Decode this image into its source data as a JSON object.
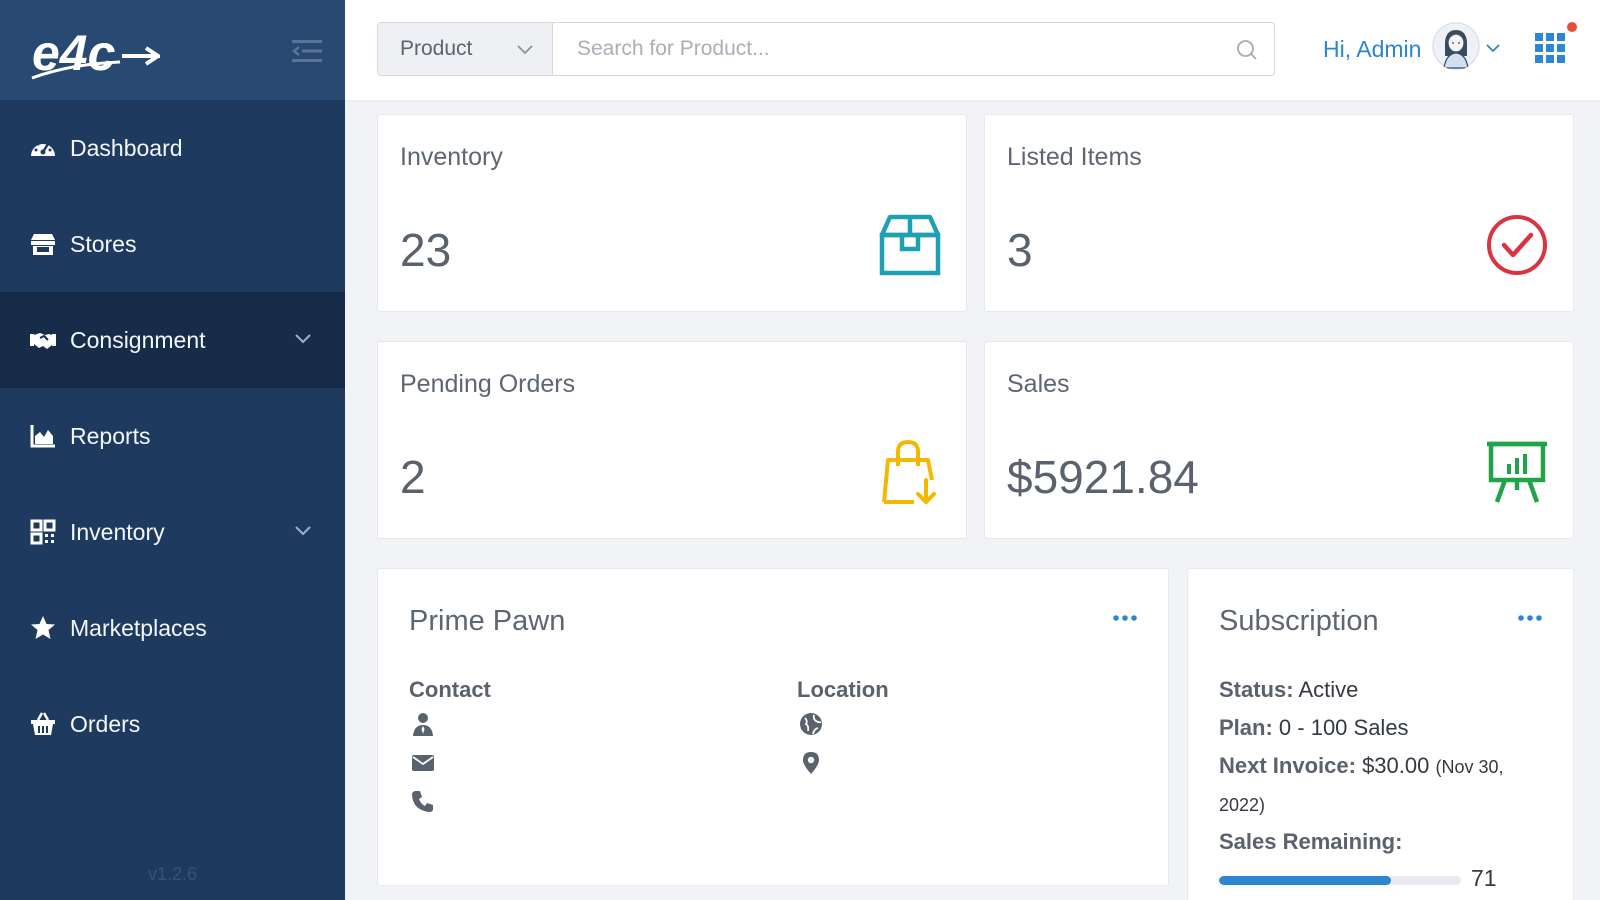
{
  "sidebar": {
    "logo_text": "e4c",
    "version": "v1.2.6",
    "items": [
      {
        "label": "Dashboard"
      },
      {
        "label": "Stores"
      },
      {
        "label": "Consignment"
      },
      {
        "label": "Reports"
      },
      {
        "label": "Inventory"
      },
      {
        "label": "Marketplaces"
      },
      {
        "label": "Orders"
      }
    ]
  },
  "topbar": {
    "search_type": "Product",
    "search_placeholder": "Search for Product...",
    "greeting": "Hi, Admin"
  },
  "stats": {
    "inventory": {
      "title": "Inventory",
      "value": "23",
      "icon": "box-icon",
      "color": "#1ea0b3"
    },
    "listed": {
      "title": "Listed Items",
      "value": "3",
      "icon": "check-circle-icon",
      "color": "#d9343f"
    },
    "pending": {
      "title": "Pending Orders",
      "value": "2",
      "icon": "shopping-bag-download-icon",
      "color": "#f5b800"
    },
    "sales": {
      "title": "Sales",
      "value": "$5921.84",
      "icon": "presentation-chart-icon",
      "color": "#23a347"
    }
  },
  "store": {
    "title": "Prime Pawn",
    "contact_heading": "Contact",
    "location_heading": "Location"
  },
  "subscription": {
    "title": "Subscription",
    "status_label": "Status:",
    "status_value": "Active",
    "plan_label": "Plan:",
    "plan_value": "0 - 100 Sales",
    "invoice_label": "Next Invoice:",
    "invoice_value": "$30.00",
    "invoice_date_a": "(Nov 30,",
    "invoice_date_b": "2022)",
    "remaining_label": "Sales Remaining:",
    "remaining_value": "71",
    "remaining_progress": 0.71
  },
  "colors": {
    "sidebar": "#1f3a5f",
    "sidebar_active": "#172c49",
    "accent": "#2d86d1"
  }
}
